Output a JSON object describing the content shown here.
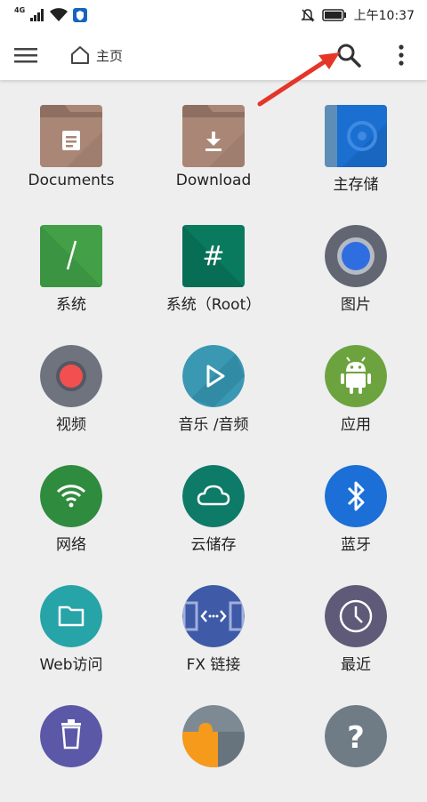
{
  "status_bar": {
    "network": "4G",
    "time": "上午10:37"
  },
  "app_bar": {
    "home_label": "主页"
  },
  "grid": [
    {
      "label": "Documents",
      "icon": "documents-folder-icon",
      "color": "#a98676"
    },
    {
      "label": "Download",
      "icon": "download-folder-icon",
      "color": "#a98676"
    },
    {
      "label": "主存储",
      "icon": "main-storage-icon",
      "color": "#1a6fd0"
    },
    {
      "label": "系统",
      "icon": "system-icon",
      "color": "#43a047"
    },
    {
      "label": "系统（Root）",
      "icon": "system-root-icon",
      "color": "#0a7a5f"
    },
    {
      "label": "图片",
      "icon": "pictures-icon",
      "color": "#616672"
    },
    {
      "label": "视频",
      "icon": "video-icon",
      "color": "#6e737d"
    },
    {
      "label": "音乐 /音频",
      "icon": "music-audio-icon",
      "color": "#3a98b2"
    },
    {
      "label": "应用",
      "icon": "apps-android-icon",
      "color": "#6da33f"
    },
    {
      "label": "网络",
      "icon": "network-wifi-icon",
      "color": "#2f8b3e"
    },
    {
      "label": "云储存",
      "icon": "cloud-storage-icon",
      "color": "#0e7a68"
    },
    {
      "label": "蓝牙",
      "icon": "bluetooth-icon",
      "color": "#1b6fd6"
    },
    {
      "label": "Web访问",
      "icon": "web-access-folder-icon",
      "color": "#27a4a8"
    },
    {
      "label": "FX 链接",
      "icon": "fx-connect-icon",
      "color": "#3f5aa6"
    },
    {
      "label": "最近",
      "icon": "recent-clock-icon",
      "color": "#5e5a78"
    },
    {
      "label": "",
      "icon": "trash-icon",
      "color": "#5b58a8"
    },
    {
      "label": "",
      "icon": "plugins-puzzle-icon",
      "color": "#7d8a93"
    },
    {
      "label": "",
      "icon": "help-icon",
      "color": "#6f7c86"
    }
  ]
}
